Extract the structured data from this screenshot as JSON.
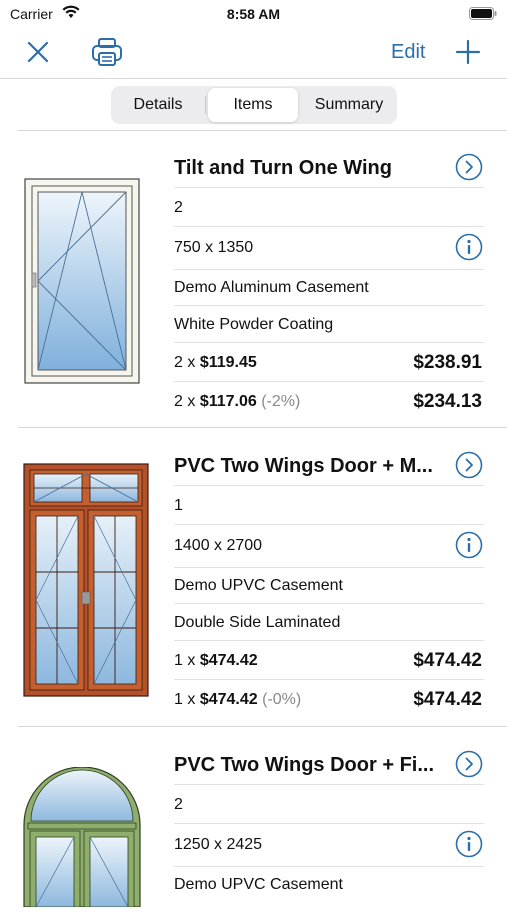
{
  "status": {
    "carrier": "Carrier",
    "time": "8:58 AM"
  },
  "nav": {
    "edit_label": "Edit"
  },
  "tabs": [
    {
      "label": "Details",
      "selected": false
    },
    {
      "label": "Items",
      "selected": true
    },
    {
      "label": "Summary",
      "selected": false
    }
  ],
  "items": [
    {
      "title": "Tilt and Turn One Wing",
      "quantity": "2",
      "size": "750 x 1350",
      "system": "Demo Aluminum Casement",
      "color": "White Powder Coating",
      "price_qty": "2",
      "unit_price": "$119.45",
      "total": "$238.91",
      "disc_qty": "2",
      "disc_unit_price": "$117.06",
      "discount": "(-2%)",
      "disc_total": "$234.13"
    },
    {
      "title": "PVC Two Wings Door + M...",
      "quantity": "1",
      "size": "1400 x 2700",
      "system": "Demo UPVC Casement",
      "color": "Double Side Laminated",
      "price_qty": "1",
      "unit_price": "$474.42",
      "total": "$474.42",
      "disc_qty": "1",
      "disc_unit_price": "$474.42",
      "discount": "(-0%)",
      "disc_total": "$474.42"
    },
    {
      "title": "PVC Two Wings Door + Fi...",
      "quantity": "2",
      "size": "1250 x 2425",
      "system": "Demo UPVC Casement"
    }
  ],
  "colors": {
    "accent": "#2b6ea8",
    "divider": "#d8d8d8",
    "muted": "#8a8a8a"
  }
}
